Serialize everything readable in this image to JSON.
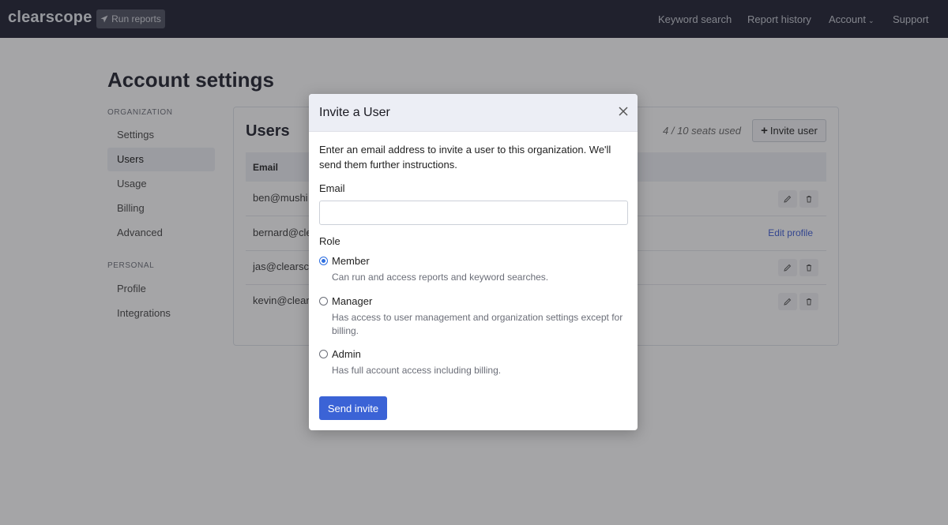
{
  "nav": {
    "logo": "clearscope",
    "run_reports": "Run reports",
    "keyword_search": "Keyword search",
    "report_history": "Report history",
    "account": "Account",
    "support": "Support"
  },
  "page": {
    "title": "Account settings"
  },
  "sidebar": {
    "organization_heading": "ORGANIZATION",
    "org_items": [
      {
        "label": "Settings"
      },
      {
        "label": "Users"
      },
      {
        "label": "Usage"
      },
      {
        "label": "Billing"
      },
      {
        "label": "Advanced"
      }
    ],
    "personal_heading": "PERSONAL",
    "personal_items": [
      {
        "label": "Profile"
      },
      {
        "label": "Integrations"
      }
    ]
  },
  "users": {
    "title": "Users",
    "seats": "4 / 10 seats used",
    "invite_label": "Invite user",
    "email_header": "Email",
    "rows": [
      {
        "email": "ben@mushi"
      },
      {
        "email": "bernard@cle",
        "link": "Edit profile"
      },
      {
        "email": "jas@clearsc"
      },
      {
        "email": "kevin@clear"
      }
    ]
  },
  "modal": {
    "title": "Invite a User",
    "intro": "Enter an email address to invite a user to this organization. We'll send them further instructions.",
    "email_label": "Email",
    "email_value": "",
    "role_label": "Role",
    "roles": [
      {
        "name": "Member",
        "desc": "Can run and access reports and keyword searches."
      },
      {
        "name": "Manager",
        "desc": "Has access to user management and organization settings except for billing."
      },
      {
        "name": "Admin",
        "desc": "Has full account access including billing."
      }
    ],
    "selected_role": "Member",
    "send_label": "Send invite"
  },
  "colors": {
    "nav_bg": "#1a1d2e",
    "accent": "#3b63d6",
    "radio_selected": "#2f6fe0"
  }
}
